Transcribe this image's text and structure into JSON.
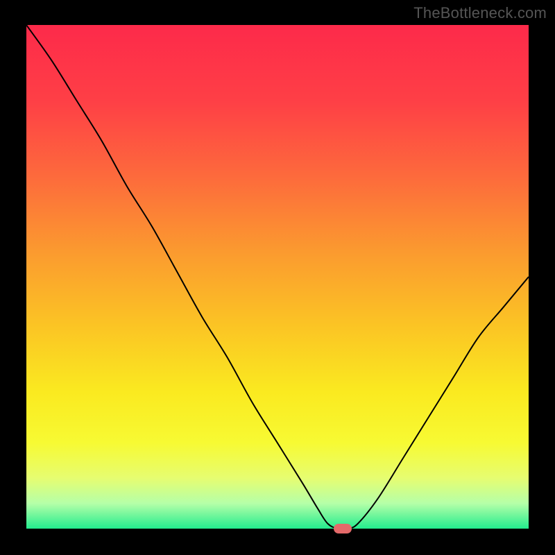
{
  "watermark": "TheBottleneck.com",
  "chart_data": {
    "type": "line",
    "title": "",
    "xlabel": "",
    "ylabel": "",
    "x": [
      0.0,
      0.05,
      0.1,
      0.15,
      0.2,
      0.25,
      0.3,
      0.35,
      0.4,
      0.45,
      0.5,
      0.55,
      0.58,
      0.6,
      0.62,
      0.64,
      0.66,
      0.7,
      0.75,
      0.8,
      0.85,
      0.9,
      0.95,
      1.0
    ],
    "y": [
      1.0,
      0.93,
      0.85,
      0.77,
      0.68,
      0.6,
      0.51,
      0.42,
      0.34,
      0.25,
      0.17,
      0.09,
      0.04,
      0.01,
      0.0,
      0.0,
      0.01,
      0.06,
      0.14,
      0.22,
      0.3,
      0.38,
      0.44,
      0.5
    ],
    "xlim": [
      0,
      1
    ],
    "ylim": [
      0,
      1
    ],
    "grid": false,
    "background_gradient": {
      "stops": [
        {
          "offset": 0.0,
          "color": "#fd2a4a"
        },
        {
          "offset": 0.15,
          "color": "#fe3f46"
        },
        {
          "offset": 0.3,
          "color": "#fd6a3c"
        },
        {
          "offset": 0.45,
          "color": "#fb9a2f"
        },
        {
          "offset": 0.6,
          "color": "#fbc524"
        },
        {
          "offset": 0.73,
          "color": "#faea20"
        },
        {
          "offset": 0.83,
          "color": "#f7fa33"
        },
        {
          "offset": 0.9,
          "color": "#e6fd71"
        },
        {
          "offset": 0.95,
          "color": "#b5ffa8"
        },
        {
          "offset": 1.0,
          "color": "#23ec8e"
        }
      ]
    },
    "marker": {
      "x": 0.63,
      "y": 0.0,
      "color": "#e46a6a"
    },
    "line_color": "#000000",
    "line_width": 2
  }
}
